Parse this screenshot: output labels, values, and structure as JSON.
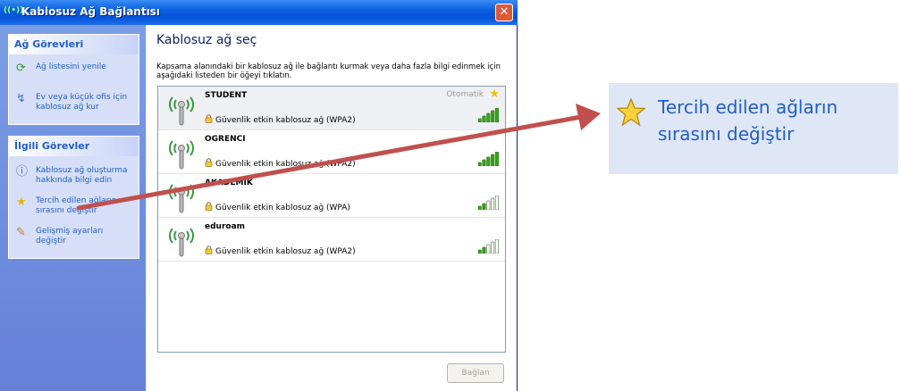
{
  "window": {
    "title": "Kablosuz Ağ Bağlantısı",
    "title_icon_text": "((•))",
    "close_glyph": "✕"
  },
  "left_pane": {
    "network_tasks": {
      "heading": "Ağ Görevleri",
      "items": [
        {
          "label": "Ağ listesini yenile",
          "icon": "refresh-icon"
        },
        {
          "label": "Ev veya küçük ofis için kablosuz ağ kur",
          "icon": "wireless-setup-icon"
        }
      ]
    },
    "related_tasks": {
      "heading": "İlgili Görevler",
      "items": [
        {
          "label": "Kablosuz ağ oluşturma hakkında bilgi edin",
          "icon": "info-icon"
        },
        {
          "label": "Tercih edilen ağların sırasını değiştir",
          "icon": "star-icon"
        },
        {
          "label": "Gelişmiş ayarları değiştir",
          "icon": "settings-icon"
        }
      ]
    }
  },
  "main": {
    "title": "Kablosuz ağ seç",
    "description": "Kapsama alanındaki bir kablosuz ağ ile bağlantı kurmak veya daha fazla bilgi edinmek için aşağıdaki listeden bir öğeyi tıklatın.",
    "networks": [
      {
        "name": "STUDENT",
        "security": "Güvenlik etkin kablosuz ağ (WPA2)",
        "status": "Otomatik",
        "starred": true,
        "signal_bars": 5,
        "selected": true
      },
      {
        "name": "OGRENCI",
        "security": "Güvenlik etkin kablosuz ağ (WPA2)",
        "status": "",
        "starred": false,
        "signal_bars": 5,
        "selected": false
      },
      {
        "name": "AKADEMIK",
        "security": "Güvenlik etkin kablosuz ağ (WPA)",
        "status": "",
        "starred": false,
        "signal_bars": 2,
        "selected": false
      },
      {
        "name": "eduroam",
        "security": "Güvenlik etkin kablosuz ağ (WPA2)",
        "status": "",
        "starred": false,
        "signal_bars": 2,
        "selected": false
      }
    ],
    "connect_button": "Bağlan"
  },
  "callout": {
    "line1": "Tercih edilen ağların",
    "line2": "sırasını değiştir"
  },
  "colors": {
    "accent": "#215dc6",
    "arrow": "#c0504d",
    "signal_on": "#3ca21c",
    "signal_off": "#ffffff"
  }
}
